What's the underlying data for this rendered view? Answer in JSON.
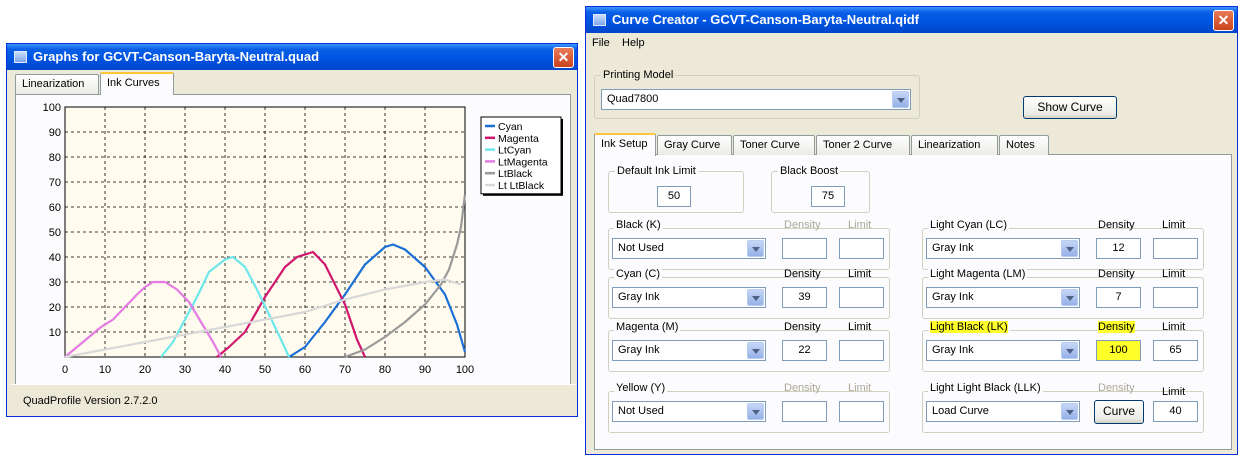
{
  "graphs_window": {
    "title": "Graphs for GCVT-Canson-Baryta-Neutral.quad",
    "close_glyph": "✕",
    "tabs": [
      {
        "label": "Linearization",
        "active": false
      },
      {
        "label": "Ink Curves",
        "active": true
      }
    ],
    "version": "QuadProfile Version 2.7.2.0"
  },
  "chart_data": {
    "type": "line",
    "title": "",
    "xlabel": "",
    "ylabel": "",
    "xlim": [
      0,
      100
    ],
    "ylim": [
      0,
      100
    ],
    "x_ticks": [
      0,
      10,
      20,
      30,
      40,
      50,
      60,
      70,
      80,
      90,
      100
    ],
    "y_ticks": [
      10,
      20,
      30,
      40,
      50,
      60,
      70,
      80,
      90,
      100
    ],
    "grid": true,
    "legend_position": "right",
    "series": [
      {
        "name": "Cyan",
        "color": "#1a6fd6",
        "x": [
          56,
          60,
          65,
          70,
          75,
          80,
          82,
          85,
          90,
          95,
          98,
          100
        ],
        "y": [
          0,
          4,
          14,
          25,
          37,
          44,
          45,
          43,
          36,
          25,
          13,
          2
        ]
      },
      {
        "name": "Magenta",
        "color": "#d0176d",
        "x": [
          38,
          41,
          45,
          50,
          55,
          58,
          62,
          65,
          70,
          73,
          75
        ],
        "y": [
          0,
          4,
          10,
          24,
          36,
          40,
          42,
          37,
          21,
          7,
          0
        ]
      },
      {
        "name": "LtCyan",
        "color": "#6de6ec",
        "x": [
          24,
          27,
          30,
          33,
          36,
          40,
          42,
          45,
          48,
          51,
          54,
          56
        ],
        "y": [
          0,
          6,
          15,
          24,
          34,
          39,
          40,
          36,
          27,
          17,
          7,
          0
        ]
      },
      {
        "name": "LtMagenta",
        "color": "#e37be3",
        "x": [
          0,
          3,
          6,
          9,
          12,
          15,
          18,
          20,
          22,
          25,
          28,
          31,
          34,
          37,
          39
        ],
        "y": [
          0,
          4,
          8,
          12,
          15,
          20,
          25,
          28,
          30,
          30,
          27,
          22,
          14,
          6,
          0
        ]
      },
      {
        "name": "LtBlack",
        "color": "#999999",
        "x": [
          70,
          75,
          80,
          85,
          90,
          92,
          94,
          96,
          98,
          99,
          100
        ],
        "y": [
          0,
          3,
          8,
          14,
          21,
          25,
          29,
          35,
          45,
          52,
          65
        ]
      },
      {
        "name": "Lt LtBlack",
        "color": "#d8d8d8",
        "x": [
          0,
          10,
          20,
          30,
          40,
          50,
          60,
          70,
          80,
          90,
          95,
          99
        ],
        "y": [
          0,
          3,
          6,
          9,
          12,
          15,
          18,
          23,
          27,
          30,
          31,
          29
        ]
      }
    ]
  },
  "curve_window": {
    "title": "Curve Creator - GCVT-Canson-Baryta-Neutral.qidf",
    "close_glyph": "✕",
    "menu": [
      "File",
      "Help"
    ],
    "printing_model": {
      "label": "Printing Model",
      "value": "Quad7800"
    },
    "show_curve_label": "Show Curve",
    "tabs": [
      {
        "label": "Ink Setup",
        "active": true
      },
      {
        "label": "Gray Curve",
        "active": false
      },
      {
        "label": "Toner Curve",
        "active": false
      },
      {
        "label": "Toner 2 Curve",
        "active": false
      },
      {
        "label": "Linearization",
        "active": false
      },
      {
        "label": "Notes",
        "active": false
      }
    ],
    "default_ink_limit": {
      "label": "Default Ink Limit",
      "value": "50"
    },
    "black_boost": {
      "label": "Black Boost",
      "value": "75"
    },
    "density_label": "Density",
    "limit_label": "Limit",
    "inks": [
      {
        "id": "k",
        "label": "Black (K)",
        "selection": "Not Used",
        "density": "",
        "limit": "",
        "disabled": true
      },
      {
        "id": "c",
        "label": "Cyan (C)",
        "selection": "Gray Ink",
        "density": "39",
        "limit": "",
        "disabled": false
      },
      {
        "id": "m",
        "label": "Magenta (M)",
        "selection": "Gray Ink",
        "density": "22",
        "limit": "",
        "disabled": false
      },
      {
        "id": "y",
        "label": "Yellow (Y)",
        "selection": "Not Used",
        "density": "",
        "limit": "",
        "disabled": true
      },
      {
        "id": "lc",
        "label": "Light Cyan (LC)",
        "selection": "Gray Ink",
        "density": "12",
        "limit": "",
        "disabled": false
      },
      {
        "id": "lm",
        "label": "Light Magenta (LM)",
        "selection": "Gray Ink",
        "density": "7",
        "limit": "",
        "disabled": false
      },
      {
        "id": "lk",
        "label": "Light Black (LK)",
        "selection": "Gray Ink",
        "density": "100",
        "limit": "65",
        "disabled": false
      },
      {
        "id": "llk",
        "label": "Light Light Black (LLK)",
        "selection": "Load Curve",
        "curve_button": "Curve",
        "limit": "40",
        "disabled": true
      }
    ]
  }
}
